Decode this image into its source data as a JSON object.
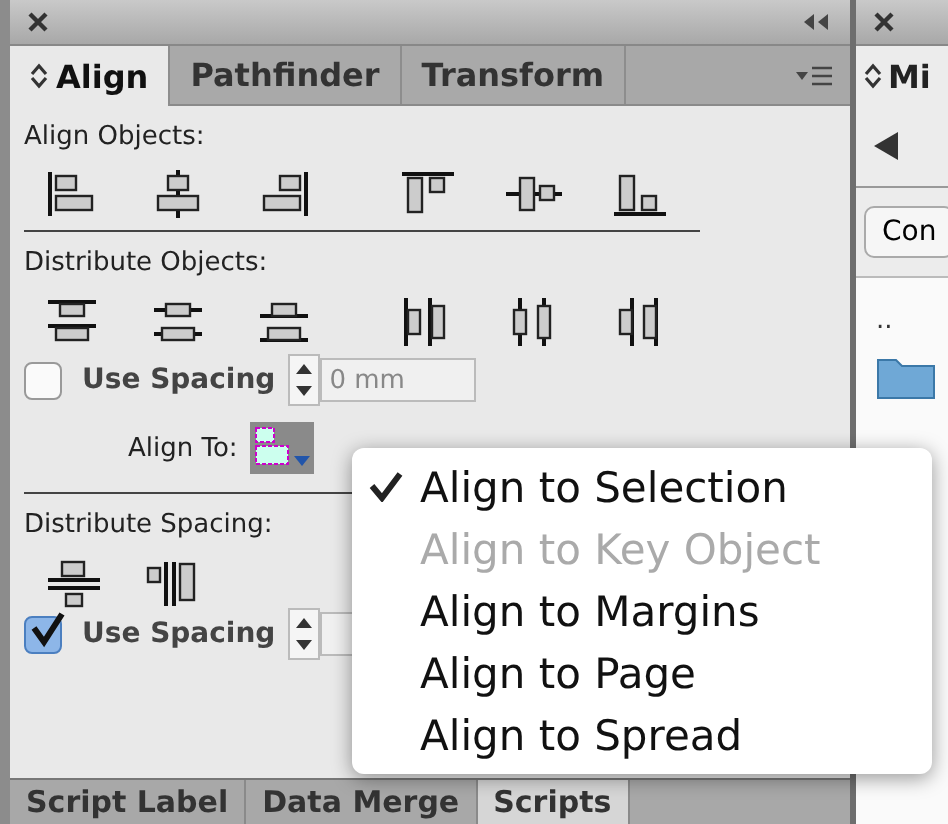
{
  "align_panel": {
    "tabs": [
      {
        "label": "Align",
        "selected": true
      },
      {
        "label": "Pathfinder",
        "selected": false
      },
      {
        "label": "Transform",
        "selected": false
      }
    ],
    "align_objects_label": "Align Objects:",
    "distribute_objects_label": "Distribute Objects:",
    "use_spacing_objects": {
      "label": "Use Spacing",
      "checked": false,
      "value": "0 mm"
    },
    "align_to_label": "Align To:",
    "distribute_spacing_label": "Distribute Spacing:",
    "use_spacing_spacing": {
      "label": "Use Spacing",
      "checked": true
    }
  },
  "align_to_menu": {
    "items": [
      {
        "label": "Align to Selection",
        "selected": true,
        "disabled": false
      },
      {
        "label": "Align to Key Object",
        "selected": false,
        "disabled": true
      },
      {
        "label": "Align to Margins",
        "selected": false,
        "disabled": false
      },
      {
        "label": "Align to Page",
        "selected": false,
        "disabled": false
      },
      {
        "label": "Align to Spread",
        "selected": false,
        "disabled": false
      }
    ]
  },
  "bottom_tabs": [
    {
      "label": "Script Label",
      "selected": false
    },
    {
      "label": "Data Merge",
      "selected": false
    },
    {
      "label": "Scripts",
      "selected": true
    }
  ],
  "side_panel": {
    "tab_label": "Mi",
    "button_label": "Con",
    "list_item": ".."
  }
}
